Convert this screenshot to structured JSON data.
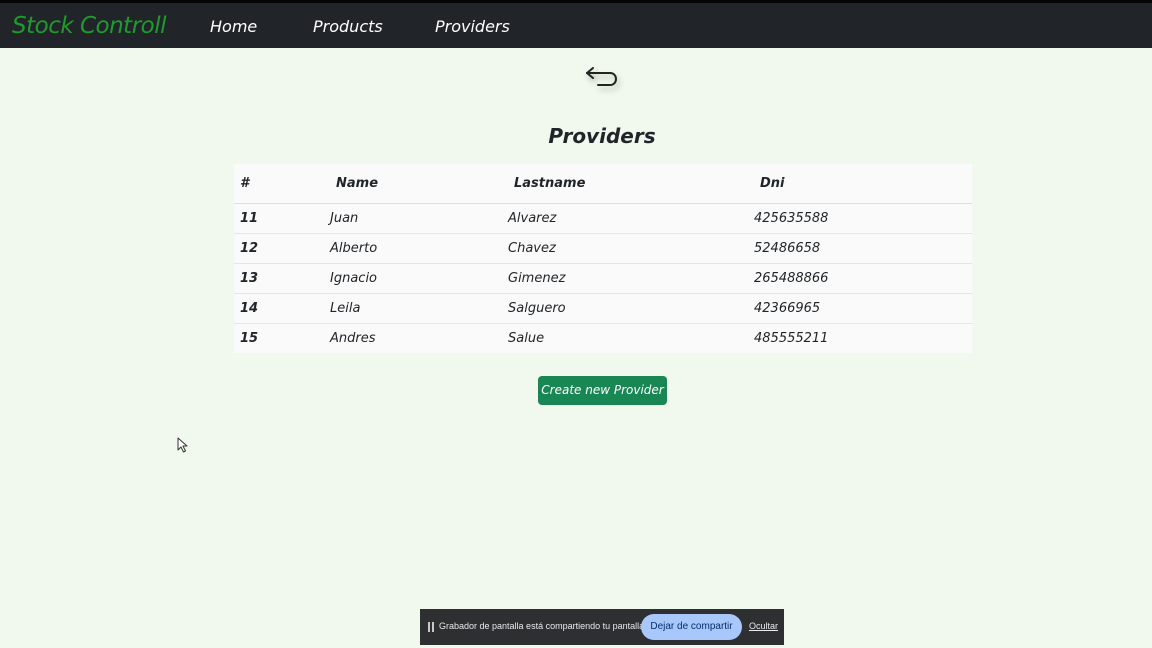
{
  "navbar": {
    "brand": "Stock Controll",
    "links": [
      "Home",
      "Products",
      "Providers"
    ]
  },
  "back_icon": "back-arrow-icon",
  "page": {
    "title": "Providers"
  },
  "table": {
    "headers": [
      "#",
      "Name",
      "Lastname",
      "Dni"
    ],
    "rows": [
      [
        "11",
        "Juan",
        "Alvarez",
        "425635588"
      ],
      [
        "12",
        "Alberto",
        "Chavez",
        "52486658"
      ],
      [
        "13",
        "Ignacio",
        "Gimenez",
        "265488866"
      ],
      [
        "14",
        "Leila",
        "Salguero",
        "42366965"
      ],
      [
        "15",
        "Andres",
        "Salue",
        "485555211"
      ]
    ]
  },
  "actions": {
    "create_label": "Create new Provider"
  },
  "share_bar": {
    "message": "Grabador de pantalla está compartiendo tu pantalla.",
    "stop_label": "Dejar de compartir",
    "hide_label": "Ocultar"
  },
  "colors": {
    "background": "#f1f9ee",
    "navbar": "#212529",
    "brand": "#1e9b2c",
    "button": "#198754"
  }
}
